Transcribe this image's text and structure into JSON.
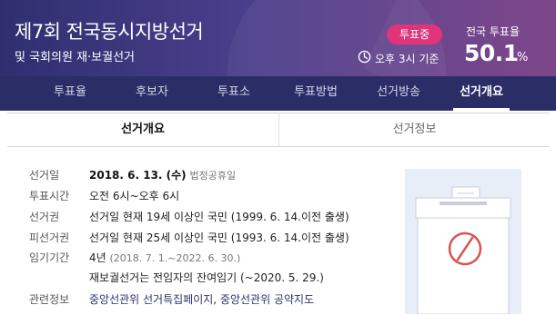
{
  "header": {
    "title": "제7회 전국동시지방선거",
    "subtitle": "및 국회의원 재·보궐선거",
    "badge": "투표중",
    "time_text": "오후 3시 기준",
    "turnout_label": "전국 투표율",
    "turnout_value": "50.1",
    "turnout_unit": "%"
  },
  "nav": {
    "items": [
      {
        "label": "투표율"
      },
      {
        "label": "후보자"
      },
      {
        "label": "투표소"
      },
      {
        "label": "투표방법"
      },
      {
        "label": "선거방송"
      },
      {
        "label": "선거개요"
      }
    ],
    "active_index": 5
  },
  "subtabs": {
    "items": [
      {
        "label": "선거개요"
      },
      {
        "label": "선거정보"
      }
    ]
  },
  "info": {
    "rows": [
      {
        "label": "선거일",
        "value_bold": "2018. 6. 13. (수)",
        "value_muted": "법정공휴일"
      },
      {
        "label": "투표시간",
        "value": "오전 6시~오후 6시"
      },
      {
        "label": "선거권",
        "value": "선거일 현재 19세 이상인 국민 (1999. 6. 14.이전 출생)"
      },
      {
        "label": "피선거권",
        "value": "선거일 현재 25세 이상인 국민 (1993. 6. 14.이전 출생)"
      },
      {
        "label": "임기기간",
        "value": "4년",
        "value_muted": "(2018. 7. 1.~2022. 6. 30.)"
      },
      {
        "label": "",
        "value": "재보궐선거는 전임자의 잔여임기 (~2020. 5. 29.)"
      },
      {
        "label": "관련정보",
        "link1": "중앙선관위 선거특집페이지",
        "sep": ", ",
        "link2": "중앙선관위 공약지도"
      }
    ]
  },
  "illustration": {
    "icon": "ballot-box-icon",
    "colors": {
      "background": "#e7eef8",
      "box": "#ffffff",
      "stamp": "#d9534f"
    }
  },
  "colors": {
    "header_start": "#2f2f6f",
    "header_end": "#7a3f86",
    "nav_bg": "#2b2e66",
    "badge": "#e0357a"
  }
}
